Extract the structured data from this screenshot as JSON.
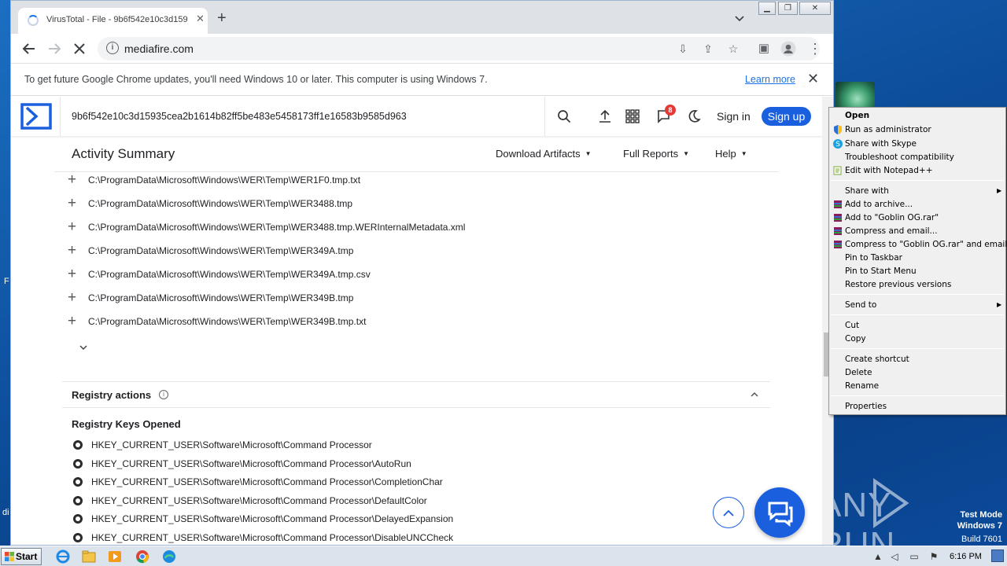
{
  "browser": {
    "tab_title": "VirusTotal - File - 9b6f542e10c3d159",
    "url": "mediafire.com",
    "infobar_message": "To get future Google Chrome updates, you'll need Windows 10 or later. This computer is using Windows 7.",
    "infobar_link": "Learn more"
  },
  "vt": {
    "hash": "9b6f542e10c3d15935cea2b1614b82ff5be483e5458173ff1e16583b9585d963",
    "notifications_count": "8",
    "sign_in": "Sign in",
    "sign_up": "Sign up",
    "summary_title": "Activity Summary",
    "menu": [
      "Download Artifacts",
      "Full Reports",
      "Help"
    ],
    "files": [
      "C:\\ProgramData\\Microsoft\\Windows\\WER\\Temp\\WER1F0.tmp.txt",
      "C:\\ProgramData\\Microsoft\\Windows\\WER\\Temp\\WER3488.tmp",
      "C:\\ProgramData\\Microsoft\\Windows\\WER\\Temp\\WER3488.tmp.WERInternalMetadata.xml",
      "C:\\ProgramData\\Microsoft\\Windows\\WER\\Temp\\WER349A.tmp",
      "C:\\ProgramData\\Microsoft\\Windows\\WER\\Temp\\WER349A.tmp.csv",
      "C:\\ProgramData\\Microsoft\\Windows\\WER\\Temp\\WER349B.tmp",
      "C:\\ProgramData\\Microsoft\\Windows\\WER\\Temp\\WER349B.tmp.txt"
    ],
    "registry_section_title": "Registry actions",
    "registry_keys_title": "Registry Keys Opened",
    "registry_keys": [
      "HKEY_CURRENT_USER\\Software\\Microsoft\\Command Processor",
      "HKEY_CURRENT_USER\\Software\\Microsoft\\Command Processor\\AutoRun",
      "HKEY_CURRENT_USER\\Software\\Microsoft\\Command Processor\\CompletionChar",
      "HKEY_CURRENT_USER\\Software\\Microsoft\\Command Processor\\DefaultColor",
      "HKEY_CURRENT_USER\\Software\\Microsoft\\Command Processor\\DelayedExpansion",
      "HKEY_CURRENT_USER\\Software\\Microsoft\\Command Processor\\DisableUNCCheck"
    ]
  },
  "context_menu": {
    "open": "Open",
    "run_as_admin": "Run as administrator",
    "share_skype": "Share with Skype",
    "troubleshoot": "Troubleshoot compatibility",
    "edit_notepad": "Edit with Notepad++",
    "share_with": "Share with",
    "add_archive": "Add to archive...",
    "add_rar": "Add to \"Goblin OG.rar\"",
    "compress_email": "Compress and email...",
    "compress_rar_email": "Compress to \"Goblin OG.rar\" and email",
    "pin_taskbar": "Pin to Taskbar",
    "pin_start": "Pin to Start Menu",
    "restore": "Restore previous versions",
    "send_to": "Send to",
    "cut": "Cut",
    "copy": "Copy",
    "create_shortcut": "Create shortcut",
    "delete": "Delete",
    "rename": "Rename",
    "properties": "Properties"
  },
  "desktop": {
    "watermark": "ANY RUN",
    "test_mode": "Test Mode",
    "os_name": "Windows 7",
    "build": "Build 7601",
    "left_frag_1": "F",
    "left_frag_2": "di"
  },
  "taskbar": {
    "start_label": "Start",
    "clock": "6:16 PM"
  }
}
